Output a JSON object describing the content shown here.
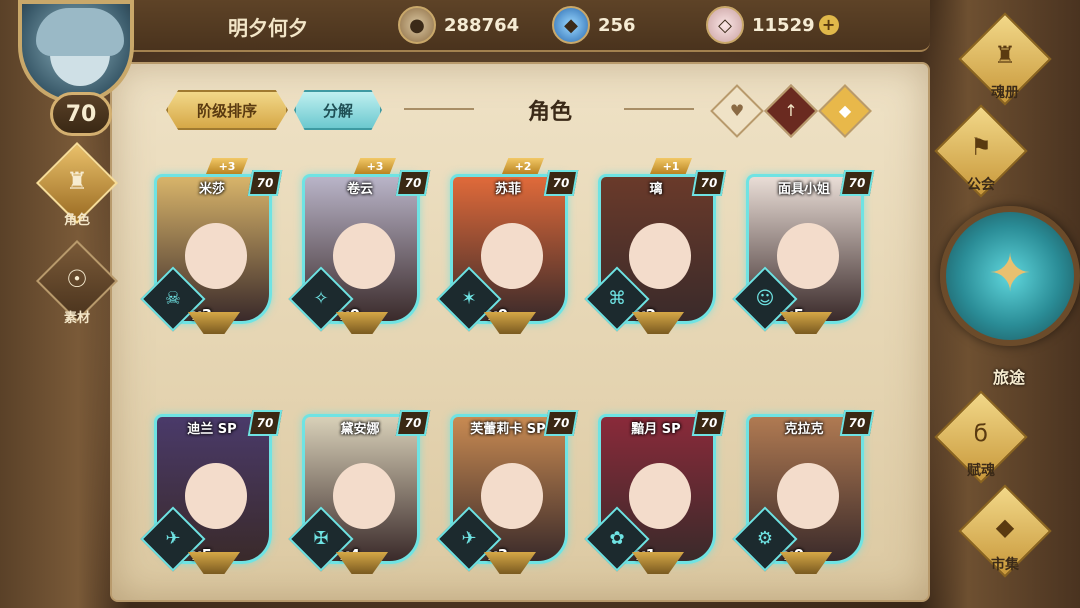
{
  "player": {
    "name": "明夕何夕",
    "level": "70"
  },
  "currencies": [
    {
      "icon": "gold-coin-icon",
      "value": "288764",
      "has_plus": false
    },
    {
      "icon": "blue-crystal-icon",
      "value": "256",
      "has_plus": false
    },
    {
      "icon": "pink-gem-icon",
      "value": "11529",
      "has_plus": true
    }
  ],
  "left_nav": [
    {
      "label": "角色",
      "icon": "helmet-icon",
      "active": true
    },
    {
      "label": "素材",
      "icon": "beast-head-icon",
      "active": false
    }
  ],
  "toolbar": {
    "sort_label": "阶级排序",
    "decompose_label": "分解",
    "title": "角色"
  },
  "filters": [
    {
      "icon": "heart-icon",
      "glyph": "♥"
    },
    {
      "icon": "sword-icon",
      "glyph": "🗡"
    },
    {
      "icon": "shield-gem-icon",
      "glyph": "◆"
    }
  ],
  "characters": [
    {
      "name": "米莎",
      "level": "70",
      "bonus": "+3",
      "count": "x3",
      "art": "#d8b46a"
    },
    {
      "name": "卷云",
      "level": "70",
      "bonus": "+3",
      "count": "x0",
      "art": "#b9b4c8"
    },
    {
      "name": "苏菲",
      "level": "70",
      "bonus": "+2",
      "count": "x0",
      "art": "#e06a3a"
    },
    {
      "name": "璃",
      "level": "70",
      "bonus": "+1",
      "count": "x2",
      "art": "#6a3a2a"
    },
    {
      "name": "面具小姐",
      "level": "70",
      "bonus": "",
      "count": "x5",
      "art": "#e9ddd6"
    },
    {
      "name": "迪兰 SP",
      "level": "70",
      "bonus": "",
      "count": "x5",
      "art": "#4a3a6a"
    },
    {
      "name": "黛安娜",
      "level": "70",
      "bonus": "",
      "count": "x4",
      "art": "#d8d0b8"
    },
    {
      "name": "芙蕾莉卡 SP",
      "level": "70",
      "bonus": "",
      "count": "x3",
      "art": "#c88a52"
    },
    {
      "name": "黯月 SP",
      "level": "70",
      "bonus": "",
      "count": "x1",
      "art": "#8a2a3a"
    },
    {
      "name": "克拉克",
      "level": "70",
      "bonus": "",
      "count": "x0",
      "art": "#b07a52"
    }
  ],
  "right_nav": [
    {
      "label": "魂册",
      "icon": "helmet-icon",
      "glyph": "♜"
    },
    {
      "label": "公会",
      "icon": "guild-banner-icon",
      "glyph": "⚑"
    },
    {
      "label": "赋魂",
      "icon": "flame-swirl-icon",
      "glyph": "ϭ"
    },
    {
      "label": "市集",
      "icon": "gem-icon",
      "glyph": "◆"
    }
  ],
  "journey": {
    "label": "旅途",
    "icon": "compass-emblem-icon"
  }
}
